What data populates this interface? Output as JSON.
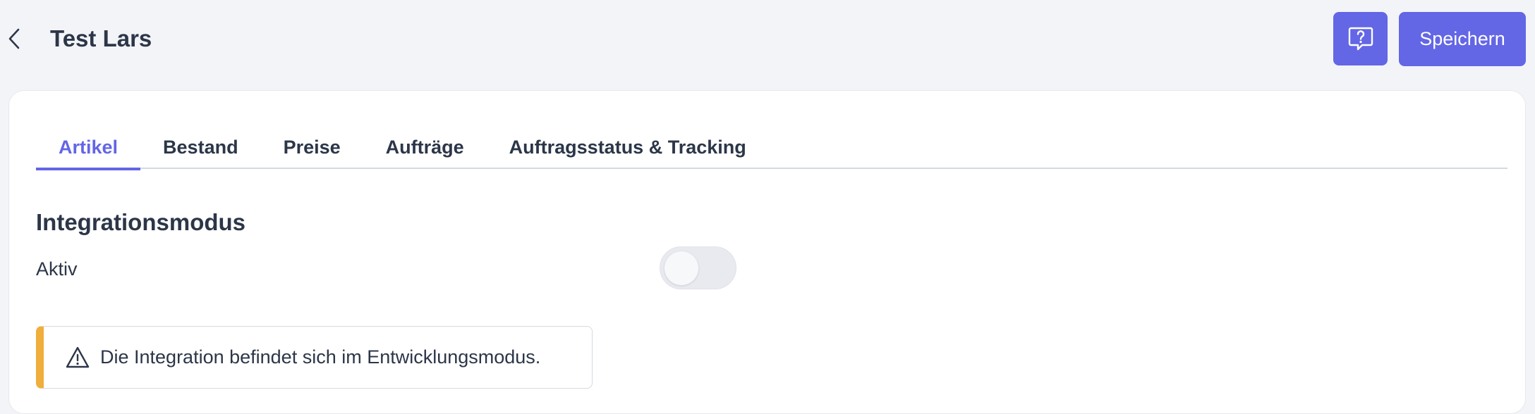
{
  "header": {
    "title": "Test Lars",
    "save_label": "Speichern"
  },
  "tabs": [
    {
      "label": "Artikel",
      "active": true
    },
    {
      "label": "Bestand",
      "active": false
    },
    {
      "label": "Preise",
      "active": false
    },
    {
      "label": "Aufträge",
      "active": false
    },
    {
      "label": "Auftragsstatus & Tracking",
      "active": false
    }
  ],
  "section": {
    "title": "Integrationsmodus",
    "toggle_label": "Aktiv",
    "toggle_on": false
  },
  "alert": {
    "text": "Die Integration befindet sich im Entwicklungsmodus."
  },
  "colors": {
    "accent": "#6366e5",
    "warning": "#f0ae3a",
    "text": "#2c3648",
    "background": "#f3f4f8"
  },
  "icons": {
    "back": "chevron-left-icon",
    "help": "help-chat-icon",
    "warning": "warning-triangle-icon"
  }
}
